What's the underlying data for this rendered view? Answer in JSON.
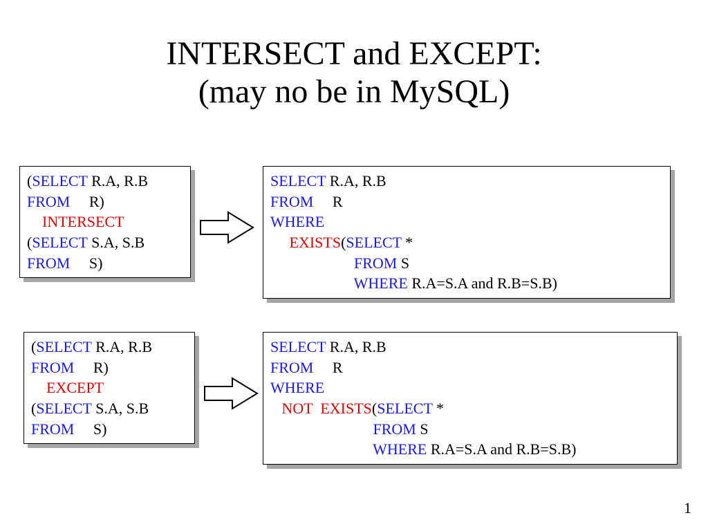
{
  "title": {
    "line1": "INTERSECT and EXCEPT:",
    "line2": "(may no be in MySQL)"
  },
  "page_number": "1",
  "colors": {
    "keyword": "#1a1adf",
    "operator": "#d60000",
    "text": "#000000"
  },
  "boxes": {
    "left_top": {
      "lines": [
        [
          {
            "t": "(",
            "c": "txt"
          },
          {
            "t": "SELECT ",
            "c": "kw"
          },
          {
            "t": "R.A, R.B",
            "c": "txt"
          }
        ],
        [
          {
            "t": "FROM     ",
            "c": "kw"
          },
          {
            "t": "R)",
            "c": "txt"
          }
        ],
        [
          {
            "t": "    ",
            "c": "txt"
          },
          {
            "t": "INTERSECT",
            "c": "op"
          }
        ],
        [
          {
            "t": "(",
            "c": "txt"
          },
          {
            "t": "SELECT ",
            "c": "kw"
          },
          {
            "t": "S.A, S.B",
            "c": "txt"
          }
        ],
        [
          {
            "t": "FROM     ",
            "c": "kw"
          },
          {
            "t": "S)",
            "c": "txt"
          }
        ]
      ]
    },
    "right_top": {
      "lines": [
        [
          {
            "t": "SELECT ",
            "c": "kw"
          },
          {
            "t": "R.A, R.B",
            "c": "txt"
          }
        ],
        [
          {
            "t": "FROM     ",
            "c": "kw"
          },
          {
            "t": "R",
            "c": "txt"
          }
        ],
        [
          {
            "t": "WHERE",
            "c": "kw"
          }
        ],
        [
          {
            "t": "     ",
            "c": "txt"
          },
          {
            "t": "EXISTS",
            "c": "op"
          },
          {
            "t": "(",
            "c": "txt"
          },
          {
            "t": "SELECT ",
            "c": "kw"
          },
          {
            "t": "*",
            "c": "txt"
          }
        ],
        [
          {
            "t": "                      ",
            "c": "txt"
          },
          {
            "t": "FROM ",
            "c": "kw"
          },
          {
            "t": "S",
            "c": "txt"
          }
        ],
        [
          {
            "t": "                      ",
            "c": "txt"
          },
          {
            "t": "WHERE ",
            "c": "kw"
          },
          {
            "t": "R.A=S.A and R.B=S.B)",
            "c": "txt"
          }
        ]
      ]
    },
    "left_bottom": {
      "lines": [
        [
          {
            "t": "(",
            "c": "txt"
          },
          {
            "t": "SELECT ",
            "c": "kw"
          },
          {
            "t": "R.A, R.B",
            "c": "txt"
          }
        ],
        [
          {
            "t": "FROM     ",
            "c": "kw"
          },
          {
            "t": "R)",
            "c": "txt"
          }
        ],
        [
          {
            "t": "    ",
            "c": "txt"
          },
          {
            "t": "EXCEPT",
            "c": "op"
          }
        ],
        [
          {
            "t": "(",
            "c": "txt"
          },
          {
            "t": "SELECT ",
            "c": "kw"
          },
          {
            "t": "S.A, S.B",
            "c": "txt"
          }
        ],
        [
          {
            "t": "FROM     ",
            "c": "kw"
          },
          {
            "t": "S)",
            "c": "txt"
          }
        ]
      ]
    },
    "right_bottom": {
      "lines": [
        [
          {
            "t": "SELECT ",
            "c": "kw"
          },
          {
            "t": "R.A, R.B",
            "c": "txt"
          }
        ],
        [
          {
            "t": "FROM     ",
            "c": "kw"
          },
          {
            "t": "R",
            "c": "txt"
          }
        ],
        [
          {
            "t": "WHERE",
            "c": "kw"
          }
        ],
        [
          {
            "t": "   ",
            "c": "txt"
          },
          {
            "t": "NOT  EXISTS",
            "c": "op"
          },
          {
            "t": "(",
            "c": "txt"
          },
          {
            "t": "SELECT ",
            "c": "kw"
          },
          {
            "t": "*",
            "c": "txt"
          }
        ],
        [
          {
            "t": "                           ",
            "c": "txt"
          },
          {
            "t": "FROM ",
            "c": "kw"
          },
          {
            "t": "S",
            "c": "txt"
          }
        ],
        [
          {
            "t": "                           ",
            "c": "txt"
          },
          {
            "t": "WHERE ",
            "c": "kw"
          },
          {
            "t": "R.A=S.A and R.B=S.B)",
            "c": "txt"
          }
        ]
      ]
    }
  }
}
